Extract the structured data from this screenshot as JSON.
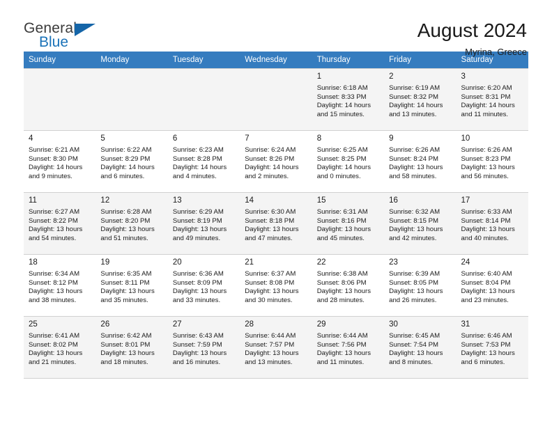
{
  "brand": {
    "name_top": "General",
    "name_bottom": "Blue",
    "triangle_color": "#1565a8",
    "blue_color": "#1a72b8"
  },
  "header": {
    "title": "August 2024",
    "subtitle": "Myrina, Greece"
  },
  "theme": {
    "header_row_bg": "#357cbf",
    "shaded_row_bg": "#f4f4f4",
    "border": "#d0d0d0"
  },
  "calendar": {
    "weekday_headers": [
      "Sunday",
      "Monday",
      "Tuesday",
      "Wednesday",
      "Thursday",
      "Friday",
      "Saturday"
    ],
    "weeks": [
      [
        {
          "day": "",
          "info": ""
        },
        {
          "day": "",
          "info": ""
        },
        {
          "day": "",
          "info": ""
        },
        {
          "day": "",
          "info": ""
        },
        {
          "day": "1",
          "info": "Sunrise: 6:18 AM\nSunset: 8:33 PM\nDaylight: 14 hours\nand 15 minutes."
        },
        {
          "day": "2",
          "info": "Sunrise: 6:19 AM\nSunset: 8:32 PM\nDaylight: 14 hours\nand 13 minutes."
        },
        {
          "day": "3",
          "info": "Sunrise: 6:20 AM\nSunset: 8:31 PM\nDaylight: 14 hours\nand 11 minutes."
        }
      ],
      [
        {
          "day": "4",
          "info": "Sunrise: 6:21 AM\nSunset: 8:30 PM\nDaylight: 14 hours\nand 9 minutes."
        },
        {
          "day": "5",
          "info": "Sunrise: 6:22 AM\nSunset: 8:29 PM\nDaylight: 14 hours\nand 6 minutes."
        },
        {
          "day": "6",
          "info": "Sunrise: 6:23 AM\nSunset: 8:28 PM\nDaylight: 14 hours\nand 4 minutes."
        },
        {
          "day": "7",
          "info": "Sunrise: 6:24 AM\nSunset: 8:26 PM\nDaylight: 14 hours\nand 2 minutes."
        },
        {
          "day": "8",
          "info": "Sunrise: 6:25 AM\nSunset: 8:25 PM\nDaylight: 14 hours\nand 0 minutes."
        },
        {
          "day": "9",
          "info": "Sunrise: 6:26 AM\nSunset: 8:24 PM\nDaylight: 13 hours\nand 58 minutes."
        },
        {
          "day": "10",
          "info": "Sunrise: 6:26 AM\nSunset: 8:23 PM\nDaylight: 13 hours\nand 56 minutes."
        }
      ],
      [
        {
          "day": "11",
          "info": "Sunrise: 6:27 AM\nSunset: 8:22 PM\nDaylight: 13 hours\nand 54 minutes."
        },
        {
          "day": "12",
          "info": "Sunrise: 6:28 AM\nSunset: 8:20 PM\nDaylight: 13 hours\nand 51 minutes."
        },
        {
          "day": "13",
          "info": "Sunrise: 6:29 AM\nSunset: 8:19 PM\nDaylight: 13 hours\nand 49 minutes."
        },
        {
          "day": "14",
          "info": "Sunrise: 6:30 AM\nSunset: 8:18 PM\nDaylight: 13 hours\nand 47 minutes."
        },
        {
          "day": "15",
          "info": "Sunrise: 6:31 AM\nSunset: 8:16 PM\nDaylight: 13 hours\nand 45 minutes."
        },
        {
          "day": "16",
          "info": "Sunrise: 6:32 AM\nSunset: 8:15 PM\nDaylight: 13 hours\nand 42 minutes."
        },
        {
          "day": "17",
          "info": "Sunrise: 6:33 AM\nSunset: 8:14 PM\nDaylight: 13 hours\nand 40 minutes."
        }
      ],
      [
        {
          "day": "18",
          "info": "Sunrise: 6:34 AM\nSunset: 8:12 PM\nDaylight: 13 hours\nand 38 minutes."
        },
        {
          "day": "19",
          "info": "Sunrise: 6:35 AM\nSunset: 8:11 PM\nDaylight: 13 hours\nand 35 minutes."
        },
        {
          "day": "20",
          "info": "Sunrise: 6:36 AM\nSunset: 8:09 PM\nDaylight: 13 hours\nand 33 minutes."
        },
        {
          "day": "21",
          "info": "Sunrise: 6:37 AM\nSunset: 8:08 PM\nDaylight: 13 hours\nand 30 minutes."
        },
        {
          "day": "22",
          "info": "Sunrise: 6:38 AM\nSunset: 8:06 PM\nDaylight: 13 hours\nand 28 minutes."
        },
        {
          "day": "23",
          "info": "Sunrise: 6:39 AM\nSunset: 8:05 PM\nDaylight: 13 hours\nand 26 minutes."
        },
        {
          "day": "24",
          "info": "Sunrise: 6:40 AM\nSunset: 8:04 PM\nDaylight: 13 hours\nand 23 minutes."
        }
      ],
      [
        {
          "day": "25",
          "info": "Sunrise: 6:41 AM\nSunset: 8:02 PM\nDaylight: 13 hours\nand 21 minutes."
        },
        {
          "day": "26",
          "info": "Sunrise: 6:42 AM\nSunset: 8:01 PM\nDaylight: 13 hours\nand 18 minutes."
        },
        {
          "day": "27",
          "info": "Sunrise: 6:43 AM\nSunset: 7:59 PM\nDaylight: 13 hours\nand 16 minutes."
        },
        {
          "day": "28",
          "info": "Sunrise: 6:44 AM\nSunset: 7:57 PM\nDaylight: 13 hours\nand 13 minutes."
        },
        {
          "day": "29",
          "info": "Sunrise: 6:44 AM\nSunset: 7:56 PM\nDaylight: 13 hours\nand 11 minutes."
        },
        {
          "day": "30",
          "info": "Sunrise: 6:45 AM\nSunset: 7:54 PM\nDaylight: 13 hours\nand 8 minutes."
        },
        {
          "day": "31",
          "info": "Sunrise: 6:46 AM\nSunset: 7:53 PM\nDaylight: 13 hours\nand 6 minutes."
        }
      ]
    ]
  }
}
